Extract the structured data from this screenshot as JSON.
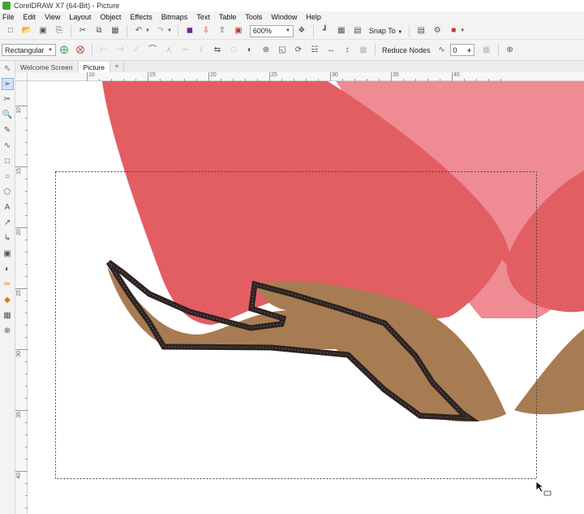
{
  "window": {
    "title": "CorelDRAW X7 (64-Bit) - Picture",
    "app_icon": "coreldraw-logo-icon"
  },
  "menu": [
    "File",
    "Edit",
    "View",
    "Layout",
    "Object",
    "Effects",
    "Bitmaps",
    "Text",
    "Table",
    "Tools",
    "Window",
    "Help"
  ],
  "standard_toolbar": {
    "zoom": "600%",
    "snap_to": "Snap To",
    "icons": [
      "new-icon",
      "open-icon",
      "save-icon",
      "print-icon",
      "cut-icon",
      "copy-icon",
      "paste-icon",
      "undo-icon",
      "redo-icon",
      "search-content-icon",
      "import-icon",
      "export-icon",
      "publish-pdf-icon",
      "full-screen-icon",
      "show-rulers-icon",
      "show-grid-icon",
      "show-guidelines-icon",
      "welcome-screen-icon",
      "options-icon",
      "application-launcher-icon"
    ]
  },
  "property_bar": {
    "selection_mode": "Rectangular",
    "reduce_nodes_label": "Reduce Nodes",
    "curve_smoothness": "0",
    "icons": [
      "add-node-icon",
      "delete-node-icon",
      "join-nodes-icon",
      "break-curve-icon",
      "convert-to-line-icon",
      "convert-to-curve-icon",
      "cusp-node-icon",
      "smooth-node-icon",
      "symmetrical-node-icon",
      "reverse-direction-icon",
      "extend-curve-icon",
      "extract-subpath-icon",
      "elastic-mode-icon",
      "stretch-nodes-icon",
      "rotate-nodes-icon",
      "align-nodes-icon",
      "reflect-horizontal-icon",
      "reflect-vertical-icon",
      "select-all-nodes-icon"
    ]
  },
  "document_tabs": [
    "Welcome Screen",
    "Picture"
  ],
  "active_tab": "Picture",
  "rulers": {
    "horizontal": [
      "10",
      "15",
      "20",
      "25",
      "30",
      "35",
      "40"
    ],
    "vertical": [
      "10",
      "15",
      "20",
      "25",
      "30",
      "35",
      "40"
    ]
  },
  "toolbox": [
    "pick-tool-icon",
    "shape-tool-icon",
    "crop-tool-icon",
    "zoom-tool-icon",
    "freehand-tool-icon",
    "artistic-media-icon",
    "rectangle-tool-icon",
    "ellipse-tool-icon",
    "polygon-tool-icon",
    "text-tool-icon",
    "parallel-dimension-icon",
    "connector-tool-icon",
    "drop-shadow-icon",
    "transparency-icon",
    "color-eyedropper-icon",
    "interactive-fill-icon",
    "smart-fill-icon",
    "add-tool-icon"
  ],
  "colors": {
    "petal_red": "#e35e62",
    "petal_pink": "#ee8b93",
    "branch_brown": "#a87c52",
    "outline_dark": "#2c2322",
    "node_dots": "#a88a7a"
  }
}
